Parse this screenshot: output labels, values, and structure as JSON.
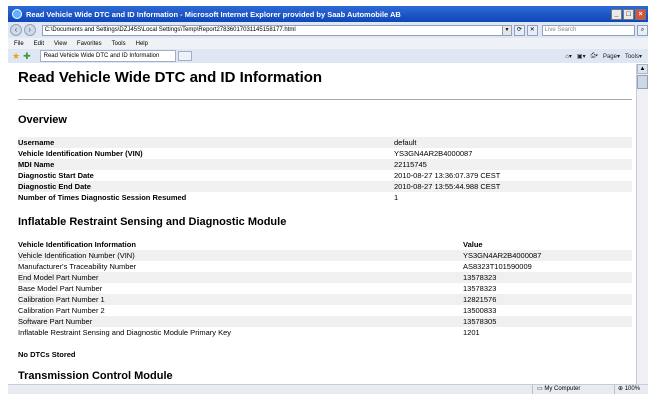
{
  "window": {
    "title": "Read Vehicle Wide DTC and ID Information - Microsoft Internet Explorer provided by Saab Automobile AB"
  },
  "navbar": {
    "address": "C:\\Documents and Settings\\DZJ45S\\Local Settings\\Temp\\Report27836017031145158177.html",
    "search_placeholder": "Live Search"
  },
  "menu": [
    "File",
    "Edit",
    "View",
    "Favorites",
    "Tools",
    "Help"
  ],
  "tab": {
    "label": "Read Vehicle Wide DTC and ID Information"
  },
  "commands": {
    "page": "Page",
    "tools": "Tools"
  },
  "page": {
    "title": "Read Vehicle Wide DTC and ID Information",
    "overview": {
      "heading": "Overview",
      "rows": [
        {
          "label": "Username",
          "value": "default"
        },
        {
          "label": "Vehicle Identification Number (VIN)",
          "value": "YS3GN4AR2B4000087"
        },
        {
          "label": "MDI Name",
          "value": "22115745"
        },
        {
          "label": "Diagnostic Start Date",
          "value": "2010-08-27 13:36:07.379 CEST"
        },
        {
          "label": "Diagnostic End Date",
          "value": "2010-08-27 13:55:44.988 CEST"
        },
        {
          "label": "Number of Times Diagnostic Session Resumed",
          "value": "1"
        }
      ]
    },
    "irsdm": {
      "heading": "Inflatable Restraint Sensing and Diagnostic Module",
      "col_headers": [
        "Vehicle Identification Information",
        "Value"
      ],
      "rows": [
        {
          "label": "Vehicle Identification Number (VIN)",
          "value": "YS3GN4AR2B4000087"
        },
        {
          "label": "Manufacturer's Traceability Number",
          "value": "AS8323T101590009"
        },
        {
          "label": "End Model Part Number",
          "value": "13578323"
        },
        {
          "label": "Base Model Part Number",
          "value": "13578323"
        },
        {
          "label": "Calibration Part Number 1",
          "value": "12821576"
        },
        {
          "label": "Calibration Part Number 2",
          "value": "13500833"
        },
        {
          "label": "Software Part Number",
          "value": "13578305"
        },
        {
          "label": "Inflatable Restraint Sensing and Diagnostic Module Primary Key",
          "value": "1201"
        }
      ],
      "note": "No DTCs Stored"
    },
    "tcm": {
      "heading": "Transmission Control Module"
    }
  },
  "status": {
    "zone": "My Computer",
    "zoom": "100%"
  }
}
